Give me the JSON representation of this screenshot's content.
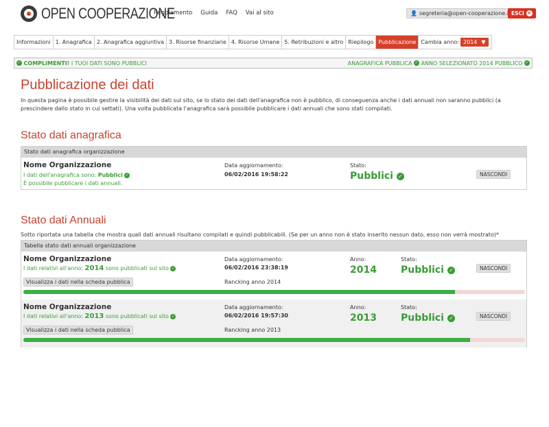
{
  "brand": {
    "logo_text": "OPEN COOPERAZIONE"
  },
  "topnav": [
    "Regolamento",
    "Guida",
    "FAQ",
    "Vai al sito"
  ],
  "user": {
    "email": "segreteria@open-cooperazione.it",
    "exit_label": "ESCI"
  },
  "tabs": [
    "Informazioni",
    "1. Anagrafica",
    "2. Anagrafica aggiuntiva",
    "3. Risorse finanziarie",
    "4. Risorse Umane",
    "5. Retribuzioni e altro",
    "Riepilogo",
    "Pubblicazione"
  ],
  "active_tab": "Pubblicazione",
  "year_select": {
    "label": "Cambia anno:",
    "value": "2014"
  },
  "success": {
    "left_bold": "COMPLIMENTI!",
    "left_rest": " I TUOI DATI SONO PUBBLICI",
    "right_1": "ANAGRAFICA PUBBLICA",
    "right_2": "ANNO SELEZIONATO 2014 PUBBLICO"
  },
  "page": {
    "title": "Pubblicazione dei dati",
    "intro": "In questa pagina è possibile gestire la visibilità dei dati sul sito, se lo stato dei dati dell'anagrafica non è pubblico, di conseguenza anche i dati annuali non saranno pubblici (a prescindere dallo stato in cui settati). Una volta pubblicata l'anagrafica sarà possibile pubblicare i dati annuali che sono stati compilati."
  },
  "anagrafica": {
    "heading": "Stato dati anagrafica",
    "table_head": "Stato dati anagrafica organizzazione",
    "org_name": "Nome Organizzazione",
    "status_line_prefix": "I dati dell'anagrafica sono: ",
    "status_line_value": "Pubblici",
    "note": "È possibile pubblicare i dati annuali.",
    "date_label": "Data aggiornamento:",
    "date_value": "06/02/2016 19:58:22",
    "state_label": "Stato:",
    "state_value": "Pubblici",
    "hide_label": "NASCONDI"
  },
  "annuali": {
    "heading": "Stato dati Annuali",
    "intro": "Sotto riportata una tabella che mostra quali dati annuali risultano compilati e quindi pubblicabili. (Se per un anno non è stato inserito nessun dato, esso non verrà mostrato)*",
    "table_head": "Tabella stato dati annuali organizzazione",
    "rows": [
      {
        "org_name": "Nome Organizzazione",
        "line_prefix": "I dati relativi all'anno: ",
        "year": "2014",
        "line_suffix": " sono pubblicati sul sito",
        "view_label": "Visualizza i dati nella scheda pubblica",
        "date_label": "Data aggiornamento:",
        "date_value": "06/02/2016 23:38:19",
        "ranking_label": "Rancking anno 2014",
        "year_label": "Anno:",
        "state_label": "Stato:",
        "state_value": "Pubblici",
        "hide_label": "NASCONDI",
        "progress": 0.86
      },
      {
        "org_name": "Nome Organizzazione",
        "line_prefix": "I dati relativi all'anno: ",
        "year": "2013",
        "line_suffix": " sono pubblicati sul sito",
        "view_label": "Visualizza i dati nella scheda pubblica",
        "date_label": "Data aggiornamento:",
        "date_value": "06/02/2016 19:57:30",
        "ranking_label": "Rancking anno 2013",
        "year_label": "Anno:",
        "state_label": "Stato:",
        "state_value": "Pubblici",
        "hide_label": "NASCONDI",
        "progress": 0.89
      }
    ]
  },
  "colors": {
    "accent": "#d6402a",
    "success": "#3a9b35",
    "progress_bg": "#f2d7d7",
    "progress_fill": "#3ab043"
  }
}
